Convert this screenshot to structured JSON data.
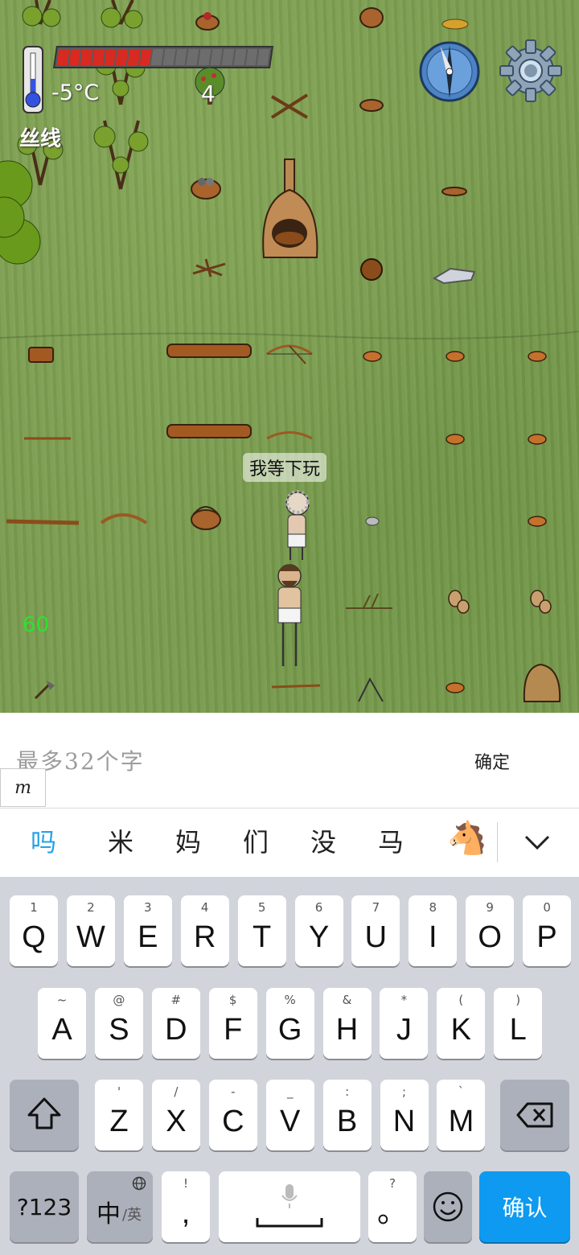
{
  "hud": {
    "temperature": "-5°C",
    "held_item": "丝线",
    "food_pips_filled": 8,
    "food_pips_total": 18,
    "counter": "4",
    "fps": "60"
  },
  "world": {
    "speech_bubble": "我等下玩"
  },
  "input": {
    "placeholder": "最多32个字",
    "confirm_label": "确定",
    "composing_text": "m"
  },
  "candidates": [
    "吗",
    "米",
    "妈",
    "们",
    "没",
    "马",
    "🐴"
  ],
  "keyboard": {
    "row1": [
      {
        "hint": "1",
        "key": "Q"
      },
      {
        "hint": "2",
        "key": "W"
      },
      {
        "hint": "3",
        "key": "E"
      },
      {
        "hint": "4",
        "key": "R"
      },
      {
        "hint": "5",
        "key": "T"
      },
      {
        "hint": "6",
        "key": "Y"
      },
      {
        "hint": "7",
        "key": "U"
      },
      {
        "hint": "8",
        "key": "I"
      },
      {
        "hint": "9",
        "key": "O"
      },
      {
        "hint": "0",
        "key": "P"
      }
    ],
    "row2": [
      {
        "hint": "~",
        "key": "A"
      },
      {
        "hint": "@",
        "key": "S"
      },
      {
        "hint": "#",
        "key": "D"
      },
      {
        "hint": "$",
        "key": "F"
      },
      {
        "hint": "%",
        "key": "G"
      },
      {
        "hint": "&",
        "key": "H"
      },
      {
        "hint": "*",
        "key": "J"
      },
      {
        "hint": "(",
        "key": "K"
      },
      {
        "hint": ")",
        "key": "L"
      }
    ],
    "row3": [
      {
        "hint": "'",
        "key": "Z"
      },
      {
        "hint": "/",
        "key": "X"
      },
      {
        "hint": "-",
        "key": "C"
      },
      {
        "hint": "_",
        "key": "V"
      },
      {
        "hint": ":",
        "key": "B"
      },
      {
        "hint": ";",
        "key": "N"
      },
      {
        "hint": "`",
        "key": "M"
      }
    ],
    "num_key": "?123",
    "lang_key_main": "中",
    "lang_key_sub": "/英",
    "punct_hint": "!",
    "punct_key": ",",
    "period_hint": "?",
    "period_key": "。",
    "confirm_key": "确认"
  },
  "colors": {
    "grass": "#799b4e",
    "food_on": "#d82a20",
    "candidate_active": "#2aa1e6",
    "confirm_key": "#0d9af0",
    "fps": "#30e030"
  }
}
